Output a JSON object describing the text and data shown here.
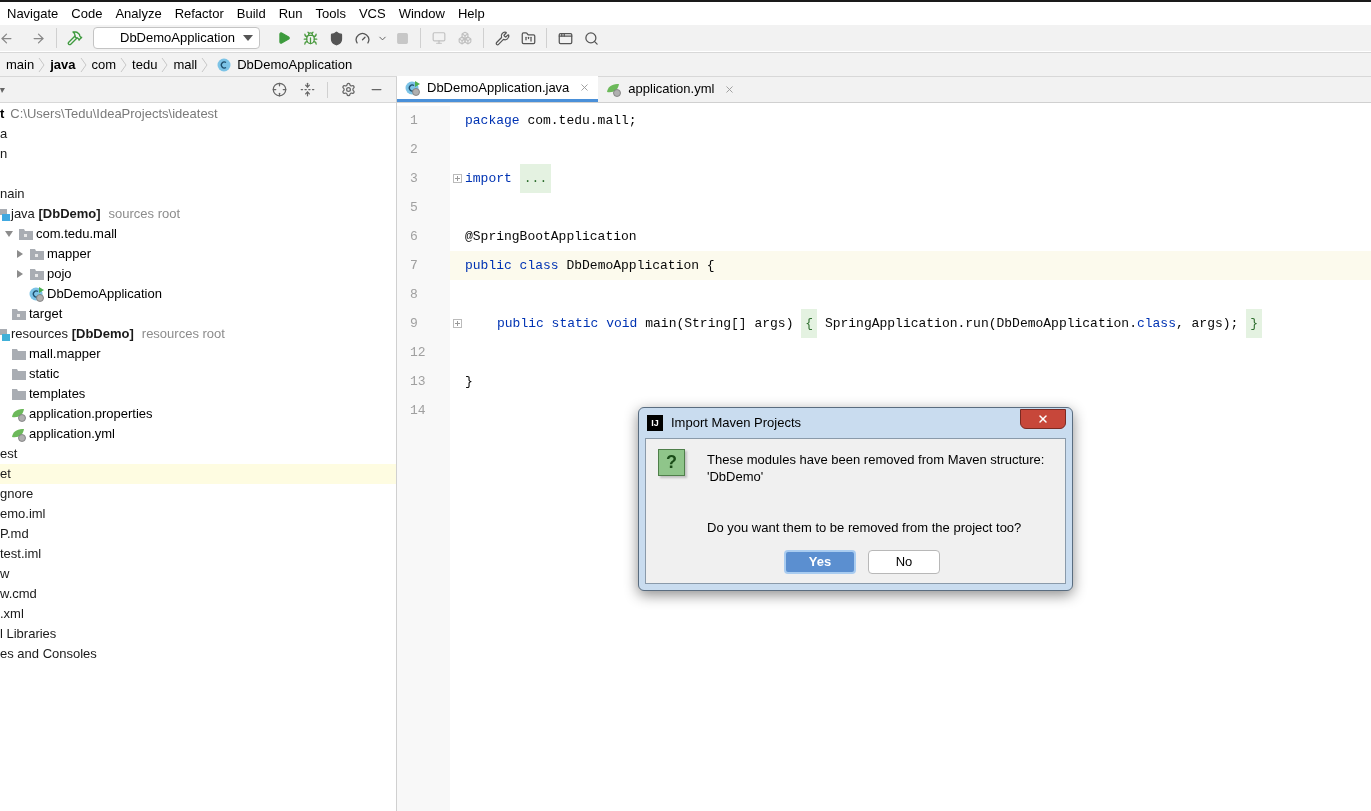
{
  "menu": [
    {
      "label": "Navigate"
    },
    {
      "label": "Code"
    },
    {
      "label": "Analyze"
    },
    {
      "label": "Refactor"
    },
    {
      "label": "Build"
    },
    {
      "label": "Run"
    },
    {
      "label": "Tools"
    },
    {
      "label": "VCS"
    },
    {
      "label": "Window"
    },
    {
      "label": "Help"
    }
  ],
  "toolbar": {
    "run_config": "DbDemoApplication"
  },
  "breadcrumbs": [
    {
      "label": "main",
      "bold": false,
      "kind": "folder"
    },
    {
      "label": "java",
      "bold": true,
      "kind": "folder"
    },
    {
      "label": "com",
      "bold": false,
      "kind": "folder"
    },
    {
      "label": "tedu",
      "bold": false,
      "kind": "folder"
    },
    {
      "label": "mall",
      "bold": false,
      "kind": "folder"
    },
    {
      "label": "DbDemoApplication",
      "bold": false,
      "kind": "class"
    }
  ],
  "project_tree": [
    {
      "label": "t",
      "path": "C:\\Users\\Tedu\\IdeaProjects\\ideatest",
      "kind": "root",
      "selected": false,
      "children": [
        {
          "label": "a",
          "selected": false
        },
        {
          "label": "n",
          "selected": false
        },
        {
          "children": [
            {
              "label": "nain",
              "selected": false,
              "children": [
                {
                  "label": "java **[DbDemo]**",
                  "hint": "sources root",
                  "kind": "source-root",
                  "selected": false,
                  "children": [
                    {
                      "label": "com.tedu.mall",
                      "kind": "package",
                      "expanded": true,
                      "selected": false,
                      "children": [
                        {
                          "label": "mapper",
                          "kind": "package",
                          "expanded": false,
                          "selected": false
                        },
                        {
                          "label": "pojo",
                          "kind": "package",
                          "expanded": false,
                          "selected": false
                        },
                        {
                          "label": "DbDemoApplication",
                          "kind": "spring-class",
                          "selected": false
                        }
                      ]
                    },
                    {
                      "label": "target",
                      "kind": "package",
                      "selected": false
                    }
                  ]
                },
                {
                  "label": "resources **[DbDemo]**",
                  "hint": "resources root",
                  "kind": "resource-root",
                  "selected": false,
                  "children": [
                    {
                      "label": "mall.mapper",
                      "kind": "folder",
                      "selected": false
                    },
                    {
                      "label": "static",
                      "kind": "folder",
                      "selected": false
                    },
                    {
                      "label": "templates",
                      "kind": "folder",
                      "selected": false
                    },
                    {
                      "label": "application.properties",
                      "kind": "spring-file",
                      "selected": false
                    },
                    {
                      "label": "application.yml",
                      "kind": "spring-file",
                      "selected": false
                    }
                  ]
                }
              ]
            },
            {
              "label": "est",
              "selected": false
            }
          ]
        },
        {
          "label": "et",
          "selected": true
        },
        {
          "label": "gnore",
          "selected": false
        },
        {
          "label": "emo.iml",
          "selected": false
        },
        {
          "label": "P.md",
          "selected": false
        },
        {
          "label": "test.iml",
          "selected": false
        },
        {
          "label": "w",
          "selected": false
        },
        {
          "label": "w.cmd",
          "selected": false
        },
        {
          "label": ".xml",
          "selected": false
        }
      ]
    },
    {
      "label": "l Libraries",
      "selected": false
    },
    {
      "label": "es and Consoles",
      "selected": false
    }
  ],
  "tabs": [
    {
      "label": "DbDemoApplication.java",
      "kind": "spring-class",
      "selected": true
    },
    {
      "label": "application.yml",
      "kind": "spring-file",
      "selected": false
    }
  ],
  "editor": {
    "lines": [
      {
        "number": "1",
        "current": false,
        "fold": false,
        "tokens": [
          {
            "text": "package",
            "kind": "keyword"
          },
          {
            "text": " com.tedu.mall;",
            "kind": "plain"
          }
        ]
      },
      {
        "number": "2",
        "current": false,
        "fold": false
      },
      {
        "number": "3",
        "current": false,
        "fold": true,
        "tokens": [
          {
            "text": "import",
            "kind": "keyword"
          },
          {
            "text": "...",
            "kind": "folded"
          }
        ]
      },
      {
        "number": "5",
        "current": false,
        "fold": false
      },
      {
        "number": "6",
        "current": false,
        "fold": false,
        "tokens": [
          {
            "text": "@SpringBootApplication",
            "kind": "plain"
          }
        ]
      },
      {
        "number": "7",
        "current": true,
        "fold": false,
        "tokens": [
          {
            "text": "public class",
            "kind": "keyword"
          },
          {
            "text": " DbDemoApplication {",
            "kind": "plain"
          }
        ]
      },
      {
        "number": "8",
        "current": false,
        "fold": false
      },
      {
        "number": "9",
        "current": false,
        "fold": true,
        "indented": true,
        "tokens": [
          {
            "text": "public static void",
            "kind": "keyword"
          },
          {
            "text": " main(String[] args) ",
            "kind": "plain"
          },
          {
            "text": "{",
            "kind": "folded"
          },
          {
            "text": " SpringApplication.run(DbDemoApplication.",
            "kind": "plain"
          },
          {
            "text": "class",
            "kind": "keyword"
          },
          {
            "text": ", args); ",
            "kind": "plain"
          },
          {
            "text": "}",
            "kind": "folded"
          }
        ]
      },
      {
        "number": "12",
        "current": false,
        "fold": false
      },
      {
        "number": "13",
        "current": false,
        "fold": false,
        "tokens": [
          {
            "text": "}",
            "kind": "plain"
          }
        ]
      },
      {
        "number": "14",
        "current": false,
        "fold": false
      }
    ]
  },
  "dialog": {
    "title": "Import Maven Projects",
    "app_badge": "IJ",
    "icon_glyph": "?",
    "message": "These modules have been removed from Maven structure:\n'DbDemo'",
    "question": "Do you want them to be removed from the project too?",
    "buttons": [
      {
        "label": "Yes",
        "selected": true
      },
      {
        "label": "No",
        "selected": false
      }
    ]
  }
}
